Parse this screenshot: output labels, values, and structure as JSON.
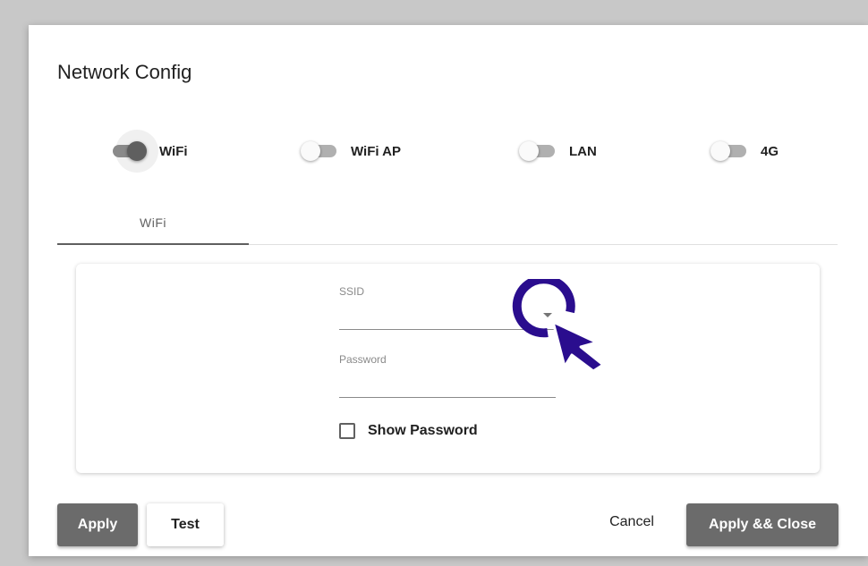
{
  "dialog": {
    "title": "Network Config",
    "toggles": [
      {
        "label": "WiFi",
        "on": true
      },
      {
        "label": "WiFi AP",
        "on": false
      },
      {
        "label": "LAN",
        "on": false
      },
      {
        "label": "4G",
        "on": false
      }
    ],
    "tabs": [
      {
        "label": "WiFi",
        "active": true
      }
    ],
    "form": {
      "ssid_label": "SSID",
      "ssid_value": "",
      "password_label": "Password",
      "password_value": "",
      "show_password_label": "Show Password",
      "show_password_checked": false
    },
    "buttons": {
      "apply": "Apply",
      "test": "Test",
      "cancel": "Cancel",
      "apply_close": "Apply && Close"
    }
  },
  "colors": {
    "accent": "#6b6b6b",
    "cursor": "#2a0d8e"
  },
  "icons": {
    "pointer": "cursor-arrow-icon",
    "click_ring": "click-ring-icon",
    "dropdown": "chevron-down-icon"
  }
}
